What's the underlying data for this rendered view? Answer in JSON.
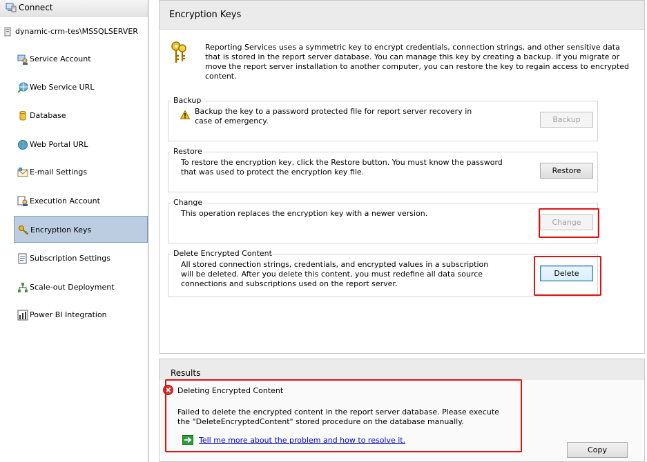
{
  "sidebar": {
    "connect_label": "Connect",
    "server_name": "dynamic-crm-tes\\MSSQLSERVER",
    "items": [
      {
        "label": "Service Account",
        "icon": "service-account-icon"
      },
      {
        "label": "Web Service URL",
        "icon": "web-service-icon"
      },
      {
        "label": "Database",
        "icon": "database-icon"
      },
      {
        "label": "Web Portal URL",
        "icon": "globe-icon"
      },
      {
        "label": "E-mail Settings",
        "icon": "email-icon"
      },
      {
        "label": "Execution Account",
        "icon": "execution-account-icon"
      },
      {
        "label": "Encryption Keys",
        "icon": "key-icon",
        "selected": true
      },
      {
        "label": "Subscription Settings",
        "icon": "subscription-icon"
      },
      {
        "label": "Scale-out Deployment",
        "icon": "scale-out-icon"
      },
      {
        "label": "Power BI Integration",
        "icon": "power-bi-icon"
      }
    ]
  },
  "main": {
    "title": "Encryption Keys",
    "intro": "Reporting Services uses a symmetric key to encrypt credentials, connection strings, and other sensitive data that is stored in the report server database.  You can manage this key by creating a backup.  If you migrate or move the report server installation to another computer, you can restore the key to regain access to encrypted content.",
    "backup": {
      "title": "Backup",
      "text": "Backup the key to a password protected file for report server recovery in case of emergency.",
      "button": "Backup"
    },
    "restore": {
      "title": "Restore",
      "text": "To restore the encryption key, click the Restore button.  You must know the password that was used to protect the encryption key file.",
      "button": "Restore"
    },
    "change": {
      "title": "Change",
      "text": "This operation replaces the encryption key with a newer version.",
      "button": "Change"
    },
    "delete": {
      "title": "Delete Encrypted Content",
      "text": "All stored connection strings, credentials, and encrypted values in a subscription will be deleted.  After you delete this content, you must redefine all data source connections and subscriptions used on the report server.",
      "button": "Delete"
    }
  },
  "results": {
    "title": "Results",
    "item_title": "Deleting Encrypted Content",
    "message": "Failed to delete the encrypted content in the report server database. Please execute the \"DeleteEncryptedContent\" stored procedure on the database manually.",
    "link": "Tell me more about the problem and how to resolve it.",
    "copy_button": "Copy"
  },
  "colors": {
    "highlight_red": "#e01010",
    "selected_bg": "#bccde1",
    "link_blue": "#0000cc",
    "error_red": "#d9342b",
    "warning_yellow": "#f5c400"
  }
}
